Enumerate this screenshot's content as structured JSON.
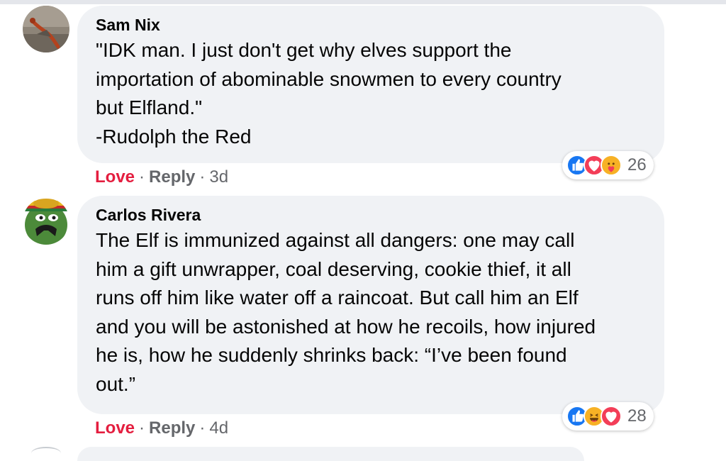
{
  "comments": [
    {
      "author": "Sam Nix",
      "lines": [
        "\"IDK man. I just don't get why elves support the",
        "importation of abominable snowmen to every country",
        "but Elfland.\"",
        "-Rudolph the Red"
      ],
      "reaction_icons": [
        "like-icon",
        "love-icon",
        "care-icon"
      ],
      "reaction_count": "26",
      "action_love": "Love",
      "action_reply": "Reply",
      "separator": "·",
      "timestamp": "3d"
    },
    {
      "author": "Carlos Rivera",
      "lines": [
        "The Elf is immunized against all dangers: one may call",
        "him a gift unwrapper, coal deserving, cookie thief, it all",
        "runs off him like water off a raincoat. But call him an Elf",
        "and you will be astonished at how he recoils, how injured",
        "he is, how he suddenly shrinks back: “I’ve been found",
        "out.”"
      ],
      "reaction_icons": [
        "like-icon",
        "haha-icon",
        "love-icon"
      ],
      "reaction_count": "28",
      "action_love": "Love",
      "action_reply": "Reply",
      "separator": "·",
      "timestamp": "4d"
    }
  ],
  "colors": {
    "bubble": "#f0f2f5",
    "love": "#e41e3f",
    "like": "#1877f2",
    "muted": "#65676b"
  }
}
